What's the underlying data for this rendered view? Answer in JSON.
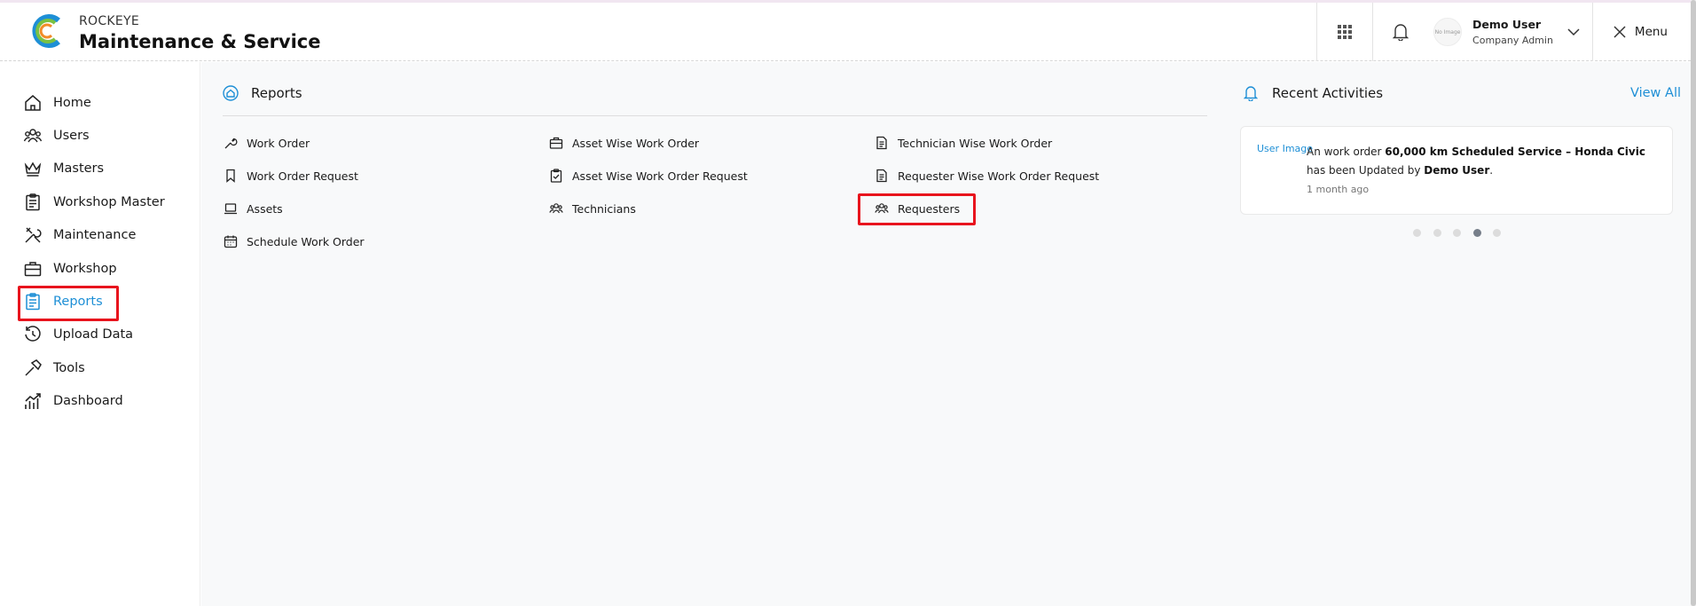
{
  "app": {
    "brand_top": "ROCKEYE",
    "brand_main": "Maintenance & Service"
  },
  "header": {
    "user_name": "Demo User",
    "user_role": "Company Admin",
    "avatar_text": "No Image",
    "menu_label": "Menu"
  },
  "sidebar": {
    "items": [
      {
        "label": "Home",
        "icon": "home-icon"
      },
      {
        "label": "Users",
        "icon": "users-icon"
      },
      {
        "label": "Masters",
        "icon": "crown-icon"
      },
      {
        "label": "Workshop Master",
        "icon": "clipboard-icon"
      },
      {
        "label": "Maintenance",
        "icon": "tools-icon"
      },
      {
        "label": "Workshop",
        "icon": "briefcase-icon"
      },
      {
        "label": "Reports",
        "icon": "report-icon",
        "active": true
      },
      {
        "label": "Upload Data",
        "icon": "history-icon"
      },
      {
        "label": "Tools",
        "icon": "hammer-icon"
      },
      {
        "label": "Dashboard",
        "icon": "chart-icon"
      }
    ]
  },
  "main": {
    "breadcrumb": "Reports",
    "links": [
      {
        "label": "Work Order",
        "icon": "wrench-icon"
      },
      {
        "label": "Asset Wise Work Order",
        "icon": "briefcase-icon"
      },
      {
        "label": "Technician Wise Work Order",
        "icon": "document-icon"
      },
      {
        "label": "Work Order Request",
        "icon": "bookmark-icon"
      },
      {
        "label": "Asset Wise Work Order Request",
        "icon": "clipboard-check-icon"
      },
      {
        "label": "Requester Wise Work Order Request",
        "icon": "document-icon"
      },
      {
        "label": "Assets",
        "icon": "laptop-icon"
      },
      {
        "label": "Technicians",
        "icon": "users-icon"
      },
      {
        "label": "Requesters",
        "icon": "users-icon"
      },
      {
        "label": "Schedule Work Order",
        "icon": "calendar-icon"
      }
    ]
  },
  "activities": {
    "title": "Recent Activities",
    "view_all": "View All",
    "item": {
      "image_alt": "User Image",
      "text_a": "An work order ",
      "text_b": "60,000 km Scheduled Service – Honda Civic",
      "text_c": " has been Updated by ",
      "text_d": "Demo User",
      "text_e": ".",
      "time": "1 month ago"
    },
    "dots_total": 5,
    "dots_active_index": 3
  },
  "colors": {
    "accent": "#1e8fd6",
    "highlight": "#e8141d",
    "main_bg": "#f8f9fa"
  }
}
